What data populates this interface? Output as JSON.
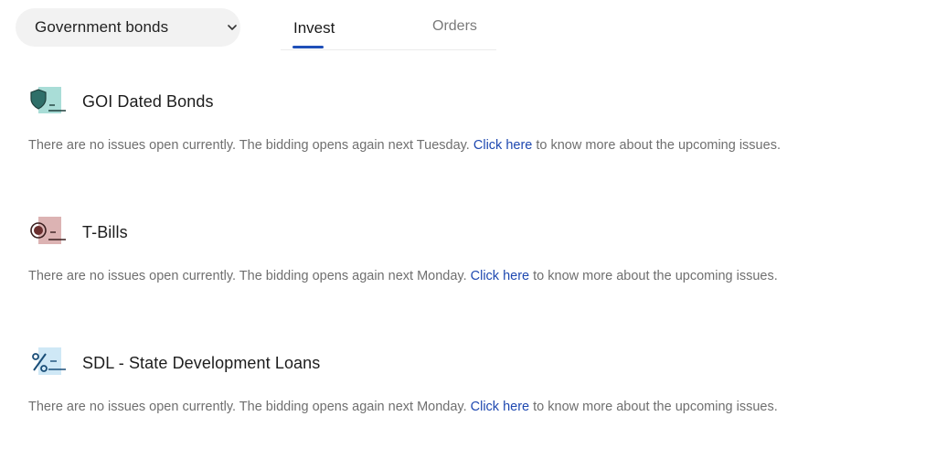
{
  "header": {
    "category_select": {
      "value": "Government bonds",
      "icon": "chevron-down-icon"
    },
    "tabs": [
      {
        "label": "Invest",
        "active": true
      },
      {
        "label": "Orders",
        "active": false
      }
    ],
    "accent_color": "#1f4fb8"
  },
  "sections": [
    {
      "title": "GOI Dated Bonds",
      "icon": "shield-icon",
      "icon_color": "#a9ddd7",
      "message_before": "There are no issues open currently. The bidding opens again next Tuesday.",
      "link_text": "Click here",
      "message_after": "to know more about the upcoming issues."
    },
    {
      "title": "T-Bills",
      "icon": "coin-icon",
      "icon_color": "#dcb3b3",
      "message_before": "There are no issues open currently. The bidding opens again next Monday.",
      "link_text": "Click here",
      "message_after": "to know more about the upcoming issues."
    },
    {
      "title": "SDL - State Development Loans",
      "icon": "percent-icon",
      "icon_color": "#cfe8f6",
      "message_before": "There are no issues open currently. The bidding opens again next Monday.",
      "link_text": "Click here",
      "message_after": "to know more about the upcoming issues."
    }
  ]
}
